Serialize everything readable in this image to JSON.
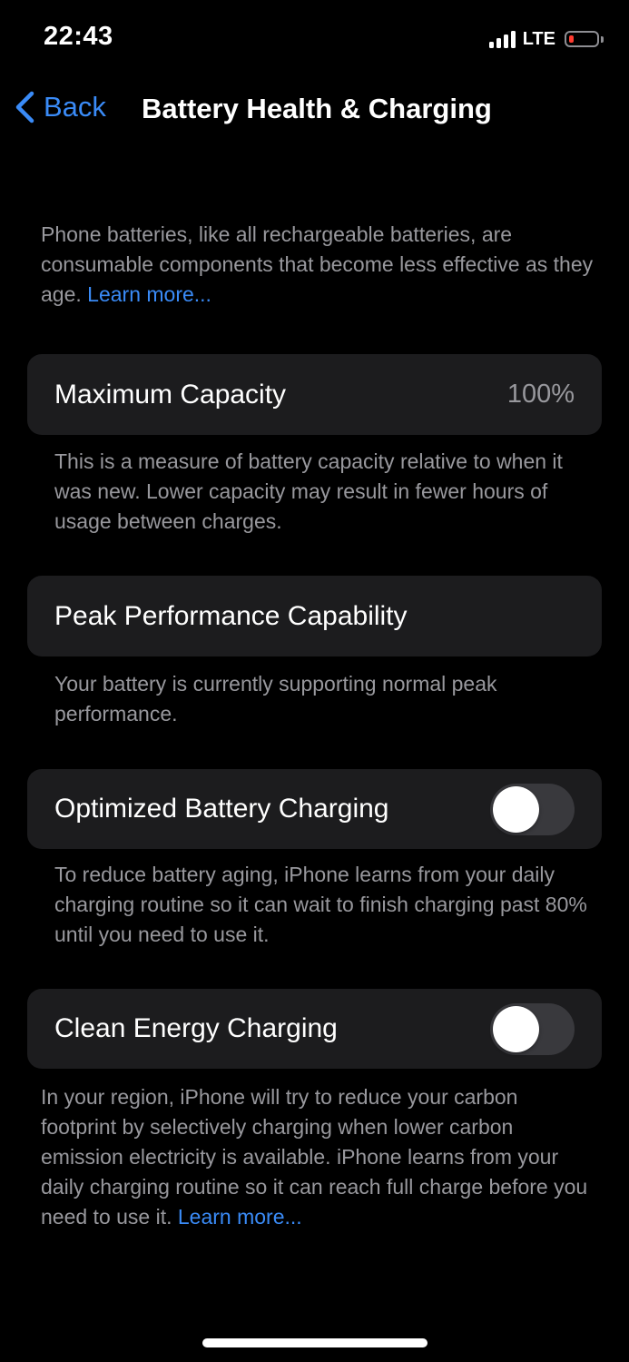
{
  "status_bar": {
    "time": "22:43",
    "network": "LTE",
    "battery_level": 0.1,
    "battery_color": "#ff3b30"
  },
  "nav": {
    "back_label": "Back",
    "title": "Battery Health & Charging",
    "accent": "#3a8bf7"
  },
  "intro": {
    "text": "Phone batteries, like all rechargeable batteries, are consumable components that become less effective as they age. ",
    "link": "Learn more..."
  },
  "max_capacity": {
    "label": "Maximum Capacity",
    "value": "100%",
    "footer": "This is a measure of battery capacity relative to when it was new. Lower capacity may result in fewer hours of usage between charges."
  },
  "peak_performance": {
    "label": "Peak Performance Capability",
    "footer": "Your battery is currently supporting normal peak performance."
  },
  "optimized_charging": {
    "label": "Optimized Battery Charging",
    "enabled": false,
    "footer": "To reduce battery aging, iPhone learns from your daily charging routine so it can wait to finish charging past 80% until you need to use it."
  },
  "clean_energy": {
    "label": "Clean Energy Charging",
    "enabled": false,
    "footer": "In your region, iPhone will try to reduce your carbon footprint by selectively charging when lower carbon emission electricity is available. iPhone learns from your daily charging routine so it can reach full charge before you need to use it. ",
    "link": "Learn more..."
  }
}
